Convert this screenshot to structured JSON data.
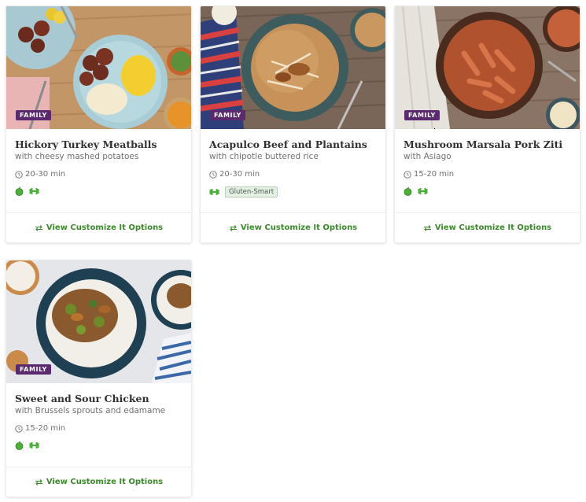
{
  "recipes": [
    {
      "badge": "FAMILY",
      "title": "Hickory Turkey Meatballs",
      "subtitle": "with cheesy mashed potatoes",
      "time": "20-30 min",
      "icons": [
        "apple-icon",
        "dumbbell-icon"
      ],
      "tag": "",
      "cta": "View Customize It Options"
    },
    {
      "badge": "FAMILY",
      "title": "Acapulco Beef and Plantains",
      "subtitle": "with chipotle buttered rice",
      "time": "20-30 min",
      "icons": [
        "dumbbell-icon"
      ],
      "tag": "Gluten-Smart",
      "cta": "View Customize It Options"
    },
    {
      "badge": "FAMILY",
      "title": "Mushroom Marsala Pork Ziti",
      "subtitle": "with Asiago",
      "time": "15-20 min",
      "icons": [
        "apple-icon",
        "dumbbell-icon"
      ],
      "tag": "",
      "cta": "View Customize It Options"
    },
    {
      "badge": "FAMILY",
      "title": "Sweet and Sour Chicken",
      "subtitle": "with Brussels sprouts and edamame",
      "time": "15-20 min",
      "icons": [
        "apple-icon",
        "dumbbell-icon"
      ],
      "tag": "",
      "cta": "View Customize It Options"
    }
  ],
  "colors": {
    "badge": "#5b2a6e",
    "cta": "#3a8a2a",
    "apple": "#4caf3a",
    "tag_bg": "#e4efe4"
  }
}
